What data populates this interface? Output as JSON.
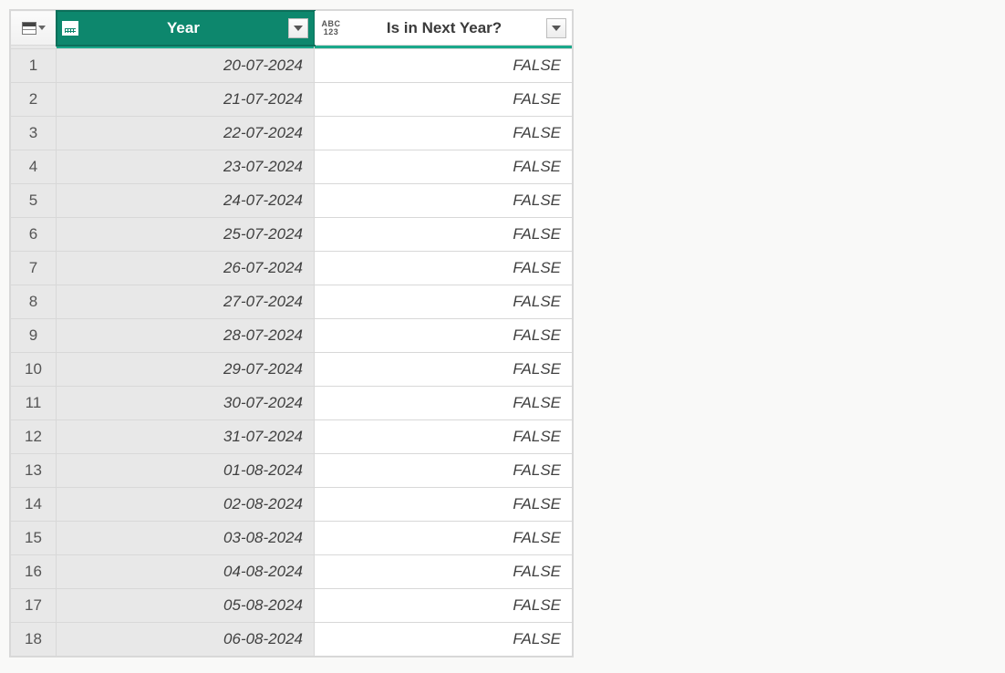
{
  "columns": {
    "year": {
      "label": "Year",
      "type_icon": "date-icon",
      "selected": true
    },
    "next": {
      "label": "Is in Next Year?",
      "type_icon": "abc123-icon",
      "selected": false,
      "abc_text": "ABC",
      "num_text": "123"
    }
  },
  "rows": [
    {
      "n": "1",
      "year": "20-07-2024",
      "next": "FALSE"
    },
    {
      "n": "2",
      "year": "21-07-2024",
      "next": "FALSE"
    },
    {
      "n": "3",
      "year": "22-07-2024",
      "next": "FALSE"
    },
    {
      "n": "4",
      "year": "23-07-2024",
      "next": "FALSE"
    },
    {
      "n": "5",
      "year": "24-07-2024",
      "next": "FALSE"
    },
    {
      "n": "6",
      "year": "25-07-2024",
      "next": "FALSE"
    },
    {
      "n": "7",
      "year": "26-07-2024",
      "next": "FALSE"
    },
    {
      "n": "8",
      "year": "27-07-2024",
      "next": "FALSE"
    },
    {
      "n": "9",
      "year": "28-07-2024",
      "next": "FALSE"
    },
    {
      "n": "10",
      "year": "29-07-2024",
      "next": "FALSE"
    },
    {
      "n": "11",
      "year": "30-07-2024",
      "next": "FALSE"
    },
    {
      "n": "12",
      "year": "31-07-2024",
      "next": "FALSE"
    },
    {
      "n": "13",
      "year": "01-08-2024",
      "next": "FALSE"
    },
    {
      "n": "14",
      "year": "02-08-2024",
      "next": "FALSE"
    },
    {
      "n": "15",
      "year": "03-08-2024",
      "next": "FALSE"
    },
    {
      "n": "16",
      "year": "04-08-2024",
      "next": "FALSE"
    },
    {
      "n": "17",
      "year": "05-08-2024",
      "next": "FALSE"
    },
    {
      "n": "18",
      "year": "06-08-2024",
      "next": "FALSE"
    }
  ]
}
